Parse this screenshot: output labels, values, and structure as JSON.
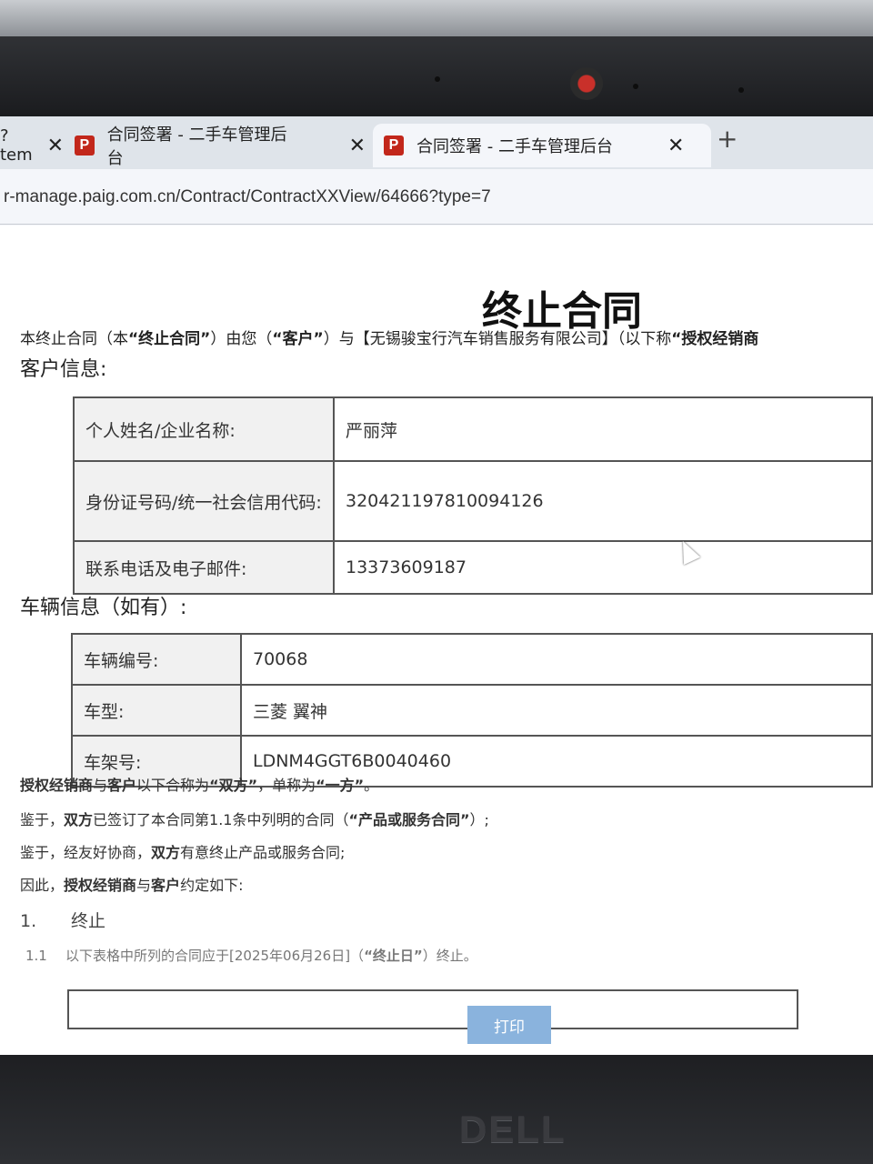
{
  "browser": {
    "tabs": [
      {
        "label": "?tem",
        "close": "✕",
        "active": false
      },
      {
        "label": "合同签署 - 二手车管理后台",
        "icon_letter": "P",
        "close": "✕",
        "active": false
      },
      {
        "label": "合同签署 - 二手车管理后台",
        "icon_letter": "P",
        "close": "✕",
        "active": true
      }
    ],
    "new_tab": "+",
    "url": "r-manage.paig.com.cn/Contract/ContractXXView/64666?type=7"
  },
  "doc": {
    "title": "终止合同",
    "intro": {
      "p1": "本终止合同（本",
      "b1": "“终止合同”",
      "p2": "）由您（",
      "b2": "“客户”",
      "p3": "）与【无锡骏宝行汽车销售服务有限公司】（以下称",
      "b3": "“授权经销商"
    },
    "customer_heading": "客户信息:",
    "customer_rows": [
      {
        "label": "个人姓名/企业名称:",
        "value": "严丽萍"
      },
      {
        "label": "身份证号码/统一社会信用代码:",
        "value": "320421197810094126"
      },
      {
        "label": "联系电话及电子邮件:",
        "value": "13373609187"
      }
    ],
    "vehicle_heading": "车辆信息（如有）:",
    "vehicle_rows": [
      {
        "label": "车辆编号:",
        "value": "70068"
      },
      {
        "label": "车型:",
        "value": "三菱 翼神"
      },
      {
        "label": "车架号:",
        "value": "LDNM4GGT6B0040460"
      }
    ],
    "para1": {
      "b1": "授权经销商",
      "t1": "与",
      "b2": "客户",
      "t2": "以下合称为",
      "b3": "“双方”",
      "t3": "，单称为",
      "b4": "“一方”",
      "t4": "。"
    },
    "para2": {
      "t1": "鉴于，",
      "b1": "双方",
      "t2": "已签订了本合同第1.1条中列明的合同（",
      "b2": "“产品或服务合同”",
      "t3": "）;"
    },
    "para3": {
      "t1": "鉴于，经友好协商，",
      "b1": "双方",
      "t2": "有意终止产品或服务合同;"
    },
    "para4": {
      "t1": "因此，",
      "b1": "授权经销商",
      "t2": "与",
      "b2": "客户",
      "t3": "约定如下:"
    },
    "clause1": {
      "num": "1.",
      "label": "终止"
    },
    "clause11": {
      "num": "1.1",
      "text": "以下表格中所列的合同应于[2025年06月26日]（",
      "b1": "“终止日”",
      "t2": "）终止。"
    },
    "print_label": "打印"
  },
  "hardware": {
    "brand": "DELL"
  }
}
